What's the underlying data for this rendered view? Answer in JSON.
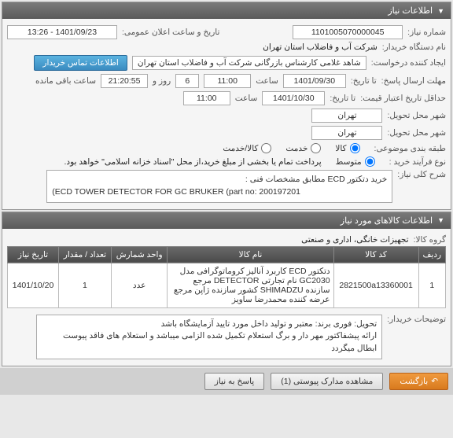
{
  "panel1": {
    "title": "اطلاعات نیاز",
    "need_no_label": "شماره نیاز:",
    "need_no": "1101005070000045",
    "announce_label": "تاریخ و ساعت اعلان عمومی:",
    "announce": "1401/09/23 - 13:26",
    "buyer_label": "نام دستگاه خریدار:",
    "buyer": "شرکت آب و فاضلاب استان تهران",
    "creator_label": "ایجاد کننده درخواست:",
    "creator": "شاهد غلامی کارشناس بازرگانی شرکت آب و فاضلاب استان تهران",
    "contact_btn": "اطلاعات تماس خریدار",
    "deadline_label": "مهلت ارسال پاسخ:",
    "deadline_prefix": "تا تاریخ:",
    "deadline_date": "1401/09/30",
    "time_label": "ساعت",
    "deadline_time": "11:00",
    "days_left": "6",
    "and_word": "روز و",
    "hours_left": "21:20:55",
    "remaining": "ساعت باقی مانده",
    "validity_label": "حداقل تاریخ اعتبار قیمت:",
    "validity_prefix": "تا تاریخ:",
    "validity_date": "1401/10/30",
    "validity_time": "11:00",
    "need_city_label": "شهر محل تحویل:",
    "need_city": "تهران",
    "delivery_city_label": "شهر محل تحویل:",
    "delivery_city": "تهران",
    "category_label": "طبقه بندی موضوعی:",
    "cat_goods": "کالا",
    "cat_service": "خدمت",
    "cat_both": "کالا/خدمت",
    "process_label": "نوع فرآیند خرید :",
    "proc_lump": "متوسط",
    "proc_note": "پرداخت تمام یا بخشی از مبلغ خرید،از محل \"اسناد خزانه اسلامی\" خواهد بود.",
    "general_label": "شرح کلی نیاز:",
    "general_line1": "خرید دتکتور ECD مطابق مشخصات فنی :",
    "general_line2": "(ECD TOWER DETECTOR FOR GC BRUKER (part no: 200197201"
  },
  "panel2": {
    "title": "اطلاعات کالاهای مورد نیاز",
    "group_label": "گروه کالا:",
    "group": "تجهیزات خانگی، اداری و صنعتی",
    "cols": {
      "row": "ردیف",
      "code": "کد کالا",
      "name": "نام کالا",
      "unit": "واحد شمارش",
      "qty": "تعداد / مقدار",
      "date": "تاریخ نیاز"
    },
    "rows": [
      {
        "idx": "1",
        "code": "2821500a13360001",
        "name": "دتکتور ECD کاربرد آنالیز کروماتوگرافی مدل GC2030 نام تجارتی DETECTOR مرجع سازنده SHIMADZU کشور سازنده ژاپن مرجع عرضه کننده محمدرضا ساویز",
        "unit": "عدد",
        "qty": "1",
        "date": "1401/10/20"
      }
    ],
    "notes_label": "توضیحات خریدار:",
    "notes": "تحویل: فوری   برند: معتبر و تولید داخل مورد تایید آزمایشگاه باشد\nارائه پیشفاکتور مهر دار و برگ استعلام تکمیل شده الزامی میباشد و استعلام های فاقد پیوست ابطال میگردد"
  },
  "footer": {
    "back": "بازگشت",
    "attach": "مشاهده مدارک پیوستی (1)",
    "reply": "پاسخ به نیاز"
  }
}
